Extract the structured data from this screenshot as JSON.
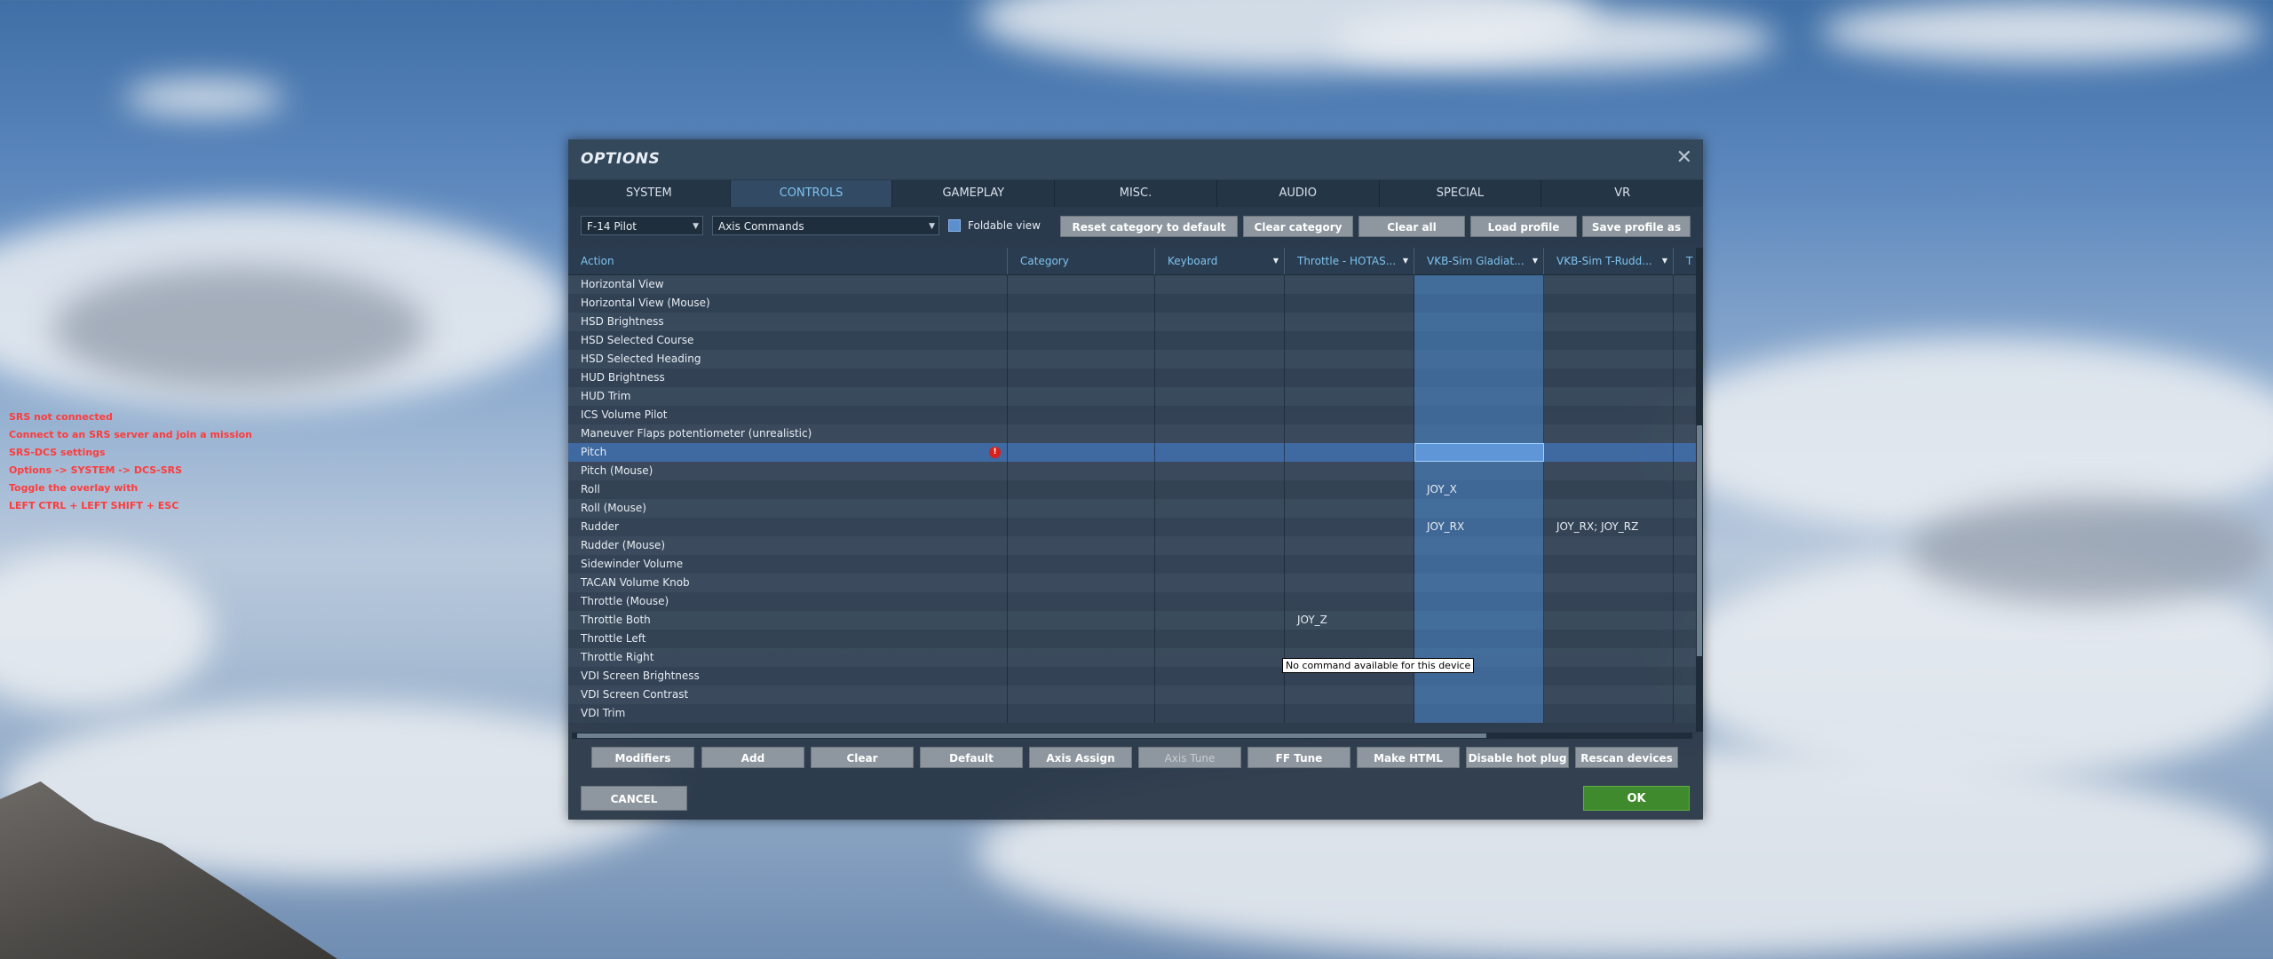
{
  "srs_overlay": [
    "SRS not connected",
    "Connect to an SRS server and join a mission",
    "SRS-DCS settings",
    "Options -> SYSTEM -> DCS-SRS",
    "Toggle the overlay with",
    "LEFT CTRL + LEFT SHIFT + ESC"
  ],
  "dialog": {
    "title": "OPTIONS",
    "close_glyph": "✕"
  },
  "tabs": [
    "SYSTEM",
    "CONTROLS",
    "GAMEPLAY",
    "MISC.",
    "AUDIO",
    "SPECIAL",
    "VR"
  ],
  "toolbar": {
    "aircraft": "F-14 Pilot",
    "category": "Axis Commands",
    "foldable_view": "Foldable view",
    "reset_category": "Reset category to default",
    "clear_category": "Clear category",
    "clear_all": "Clear all",
    "load_profile": "Load profile",
    "save_profile_as": "Save profile as"
  },
  "columns": {
    "action": "Action",
    "category": "Category",
    "keyboard": "Keyboard",
    "throttle": "Throttle - HOTAS...",
    "vkb_gladiator": "VKB-Sim Gladiat...",
    "vkb_trudder": "VKB-Sim T-Rudd...",
    "extra": "T"
  },
  "rows": [
    {
      "action": "Horizontal View",
      "throttle": "",
      "vkb": "",
      "rudder": ""
    },
    {
      "action": "Horizontal View (Mouse)",
      "throttle": "",
      "vkb": "",
      "rudder": ""
    },
    {
      "action": "HSD Brightness",
      "throttle": "",
      "vkb": "",
      "rudder": ""
    },
    {
      "action": "HSD Selected Course",
      "throttle": "",
      "vkb": "",
      "rudder": ""
    },
    {
      "action": "HSD Selected Heading",
      "throttle": "",
      "vkb": "",
      "rudder": ""
    },
    {
      "action": "HUD Brightness",
      "throttle": "",
      "vkb": "",
      "rudder": ""
    },
    {
      "action": "HUD Trim",
      "throttle": "",
      "vkb": "",
      "rudder": ""
    },
    {
      "action": "ICS Volume Pilot",
      "throttle": "",
      "vkb": "",
      "rudder": ""
    },
    {
      "action": "Maneuver Flaps potentiometer (unrealistic)",
      "throttle": "",
      "vkb": "",
      "rudder": ""
    },
    {
      "action": "Pitch",
      "throttle": "",
      "vkb": "",
      "rudder": ""
    },
    {
      "action": "Pitch (Mouse)",
      "throttle": "",
      "vkb": "",
      "rudder": ""
    },
    {
      "action": "Roll",
      "throttle": "",
      "vkb": "JOY_X",
      "rudder": ""
    },
    {
      "action": "Roll (Mouse)",
      "throttle": "",
      "vkb": "",
      "rudder": ""
    },
    {
      "action": "Rudder",
      "throttle": "",
      "vkb": "JOY_RX",
      "rudder": "JOY_RX; JOY_RZ"
    },
    {
      "action": "Rudder (Mouse)",
      "throttle": "",
      "vkb": "",
      "rudder": ""
    },
    {
      "action": "Sidewinder Volume",
      "throttle": "",
      "vkb": "",
      "rudder": ""
    },
    {
      "action": "TACAN Volume Knob",
      "throttle": "",
      "vkb": "",
      "rudder": ""
    },
    {
      "action": "Throttle (Mouse)",
      "throttle": "",
      "vkb": "",
      "rudder": ""
    },
    {
      "action": "Throttle Both",
      "throttle": "JOY_Z",
      "vkb": "",
      "rudder": ""
    },
    {
      "action": "Throttle Left",
      "throttle": "",
      "vkb": "",
      "rudder": ""
    },
    {
      "action": "Throttle Right",
      "throttle": "",
      "vkb": "",
      "rudder": ""
    },
    {
      "action": "VDI Screen Brightness",
      "throttle": "",
      "vkb": "",
      "rudder": ""
    },
    {
      "action": "VDI Screen Contrast",
      "throttle": "",
      "vkb": "",
      "rudder": ""
    },
    {
      "action": "VDI Trim",
      "throttle": "",
      "vkb": "",
      "rudder": ""
    }
  ],
  "selected_row": "Pitch",
  "tooltip": "No command available for this device",
  "bottom_buttons": [
    "Modifiers",
    "Add",
    "Clear",
    "Default",
    "Axis Assign",
    "Axis Tune",
    "FF Tune",
    "Make HTML",
    "Disable hot plug",
    "Rescan devices"
  ],
  "cancel_label": "CANCEL",
  "ok_label": "OK"
}
